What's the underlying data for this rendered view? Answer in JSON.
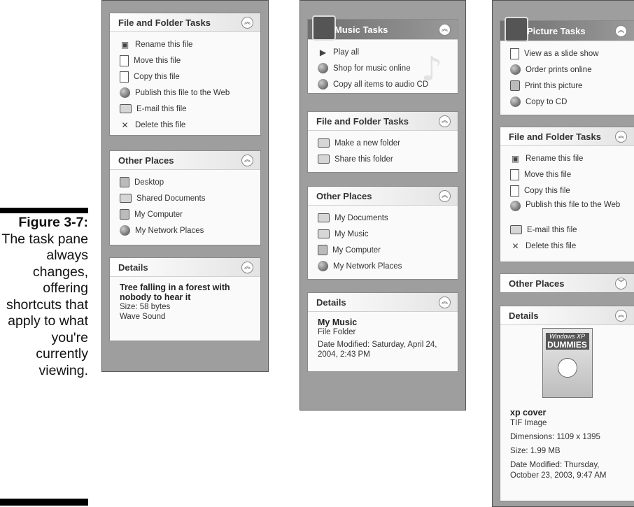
{
  "caption": {
    "figure": "Figure 3-7:",
    "text": "The task pane always changes, offering shortcuts that apply to what you're currently viewing."
  },
  "pane1": {
    "file_tasks": {
      "title": "File and Folder Tasks",
      "items": [
        {
          "label": "Rename this file",
          "icon": "rename-icon"
        },
        {
          "label": "Move this file",
          "icon": "move-icon"
        },
        {
          "label": "Copy this file",
          "icon": "copy-icon"
        },
        {
          "label": "Publish this file to the Web",
          "icon": "publish-web-icon"
        },
        {
          "label": "E-mail this file",
          "icon": "email-icon"
        },
        {
          "label": "Delete this file",
          "icon": "delete-icon"
        }
      ]
    },
    "other_places": {
      "title": "Other Places",
      "items": [
        {
          "label": "Desktop",
          "icon": "desktop-icon"
        },
        {
          "label": "Shared Documents",
          "icon": "folder-icon"
        },
        {
          "label": "My Computer",
          "icon": "computer-icon"
        },
        {
          "label": "My Network Places",
          "icon": "network-icon"
        }
      ]
    },
    "details": {
      "title": "Details",
      "name": "Tree falling in a forest with nobody to hear it",
      "size": "Size: 58 bytes",
      "type": "Wave Sound"
    }
  },
  "pane2": {
    "music_tasks": {
      "title": "Music Tasks",
      "items": [
        {
          "label": "Play all",
          "icon": "play-icon"
        },
        {
          "label": "Shop for music online",
          "icon": "shop-globe-icon"
        },
        {
          "label": "Copy all items to audio CD",
          "icon": "cd-icon"
        }
      ]
    },
    "file_tasks": {
      "title": "File and Folder Tasks",
      "items": [
        {
          "label": "Make a new folder",
          "icon": "new-folder-icon"
        },
        {
          "label": "Share this folder",
          "icon": "share-folder-icon"
        }
      ]
    },
    "other_places": {
      "title": "Other Places",
      "items": [
        {
          "label": "My Documents",
          "icon": "documents-icon"
        },
        {
          "label": "My Music",
          "icon": "folder-icon"
        },
        {
          "label": "My Computer",
          "icon": "computer-icon"
        },
        {
          "label": "My Network Places",
          "icon": "network-icon"
        }
      ]
    },
    "details": {
      "title": "Details",
      "name": "My Music",
      "type": "File Folder",
      "modified": "Date Modified: Saturday, April 24, 2004, 2:43 PM"
    }
  },
  "pane3": {
    "picture_tasks": {
      "title": "Picture Tasks",
      "items": [
        {
          "label": "View as a slide show",
          "icon": "slideshow-icon"
        },
        {
          "label": "Order prints online",
          "icon": "order-prints-icon"
        },
        {
          "label": "Print this picture",
          "icon": "print-icon"
        },
        {
          "label": "Copy to CD",
          "icon": "cd-icon"
        }
      ]
    },
    "file_tasks": {
      "title": "File and Folder Tasks",
      "items": [
        {
          "label": "Rename this file",
          "icon": "rename-icon"
        },
        {
          "label": "Move this file",
          "icon": "move-icon"
        },
        {
          "label": "Copy this file",
          "icon": "copy-icon"
        },
        {
          "label": "Publish this file to the Web",
          "icon": "publish-web-icon"
        },
        {
          "label": "E-mail this file",
          "icon": "email-icon"
        },
        {
          "label": "Delete this file",
          "icon": "delete-icon"
        }
      ]
    },
    "other_places": {
      "title": "Other Places"
    },
    "details": {
      "title": "Details",
      "cover_line1": "Windows XP",
      "cover_line2": "DUMMIES",
      "name": "xp cover",
      "type": "TIF Image",
      "dimensions": "Dimensions: 1109 x 1395",
      "size": "Size: 1.99 MB",
      "modified": "Date Modified: Thursday, October 23, 2003, 9:47 AM"
    }
  }
}
